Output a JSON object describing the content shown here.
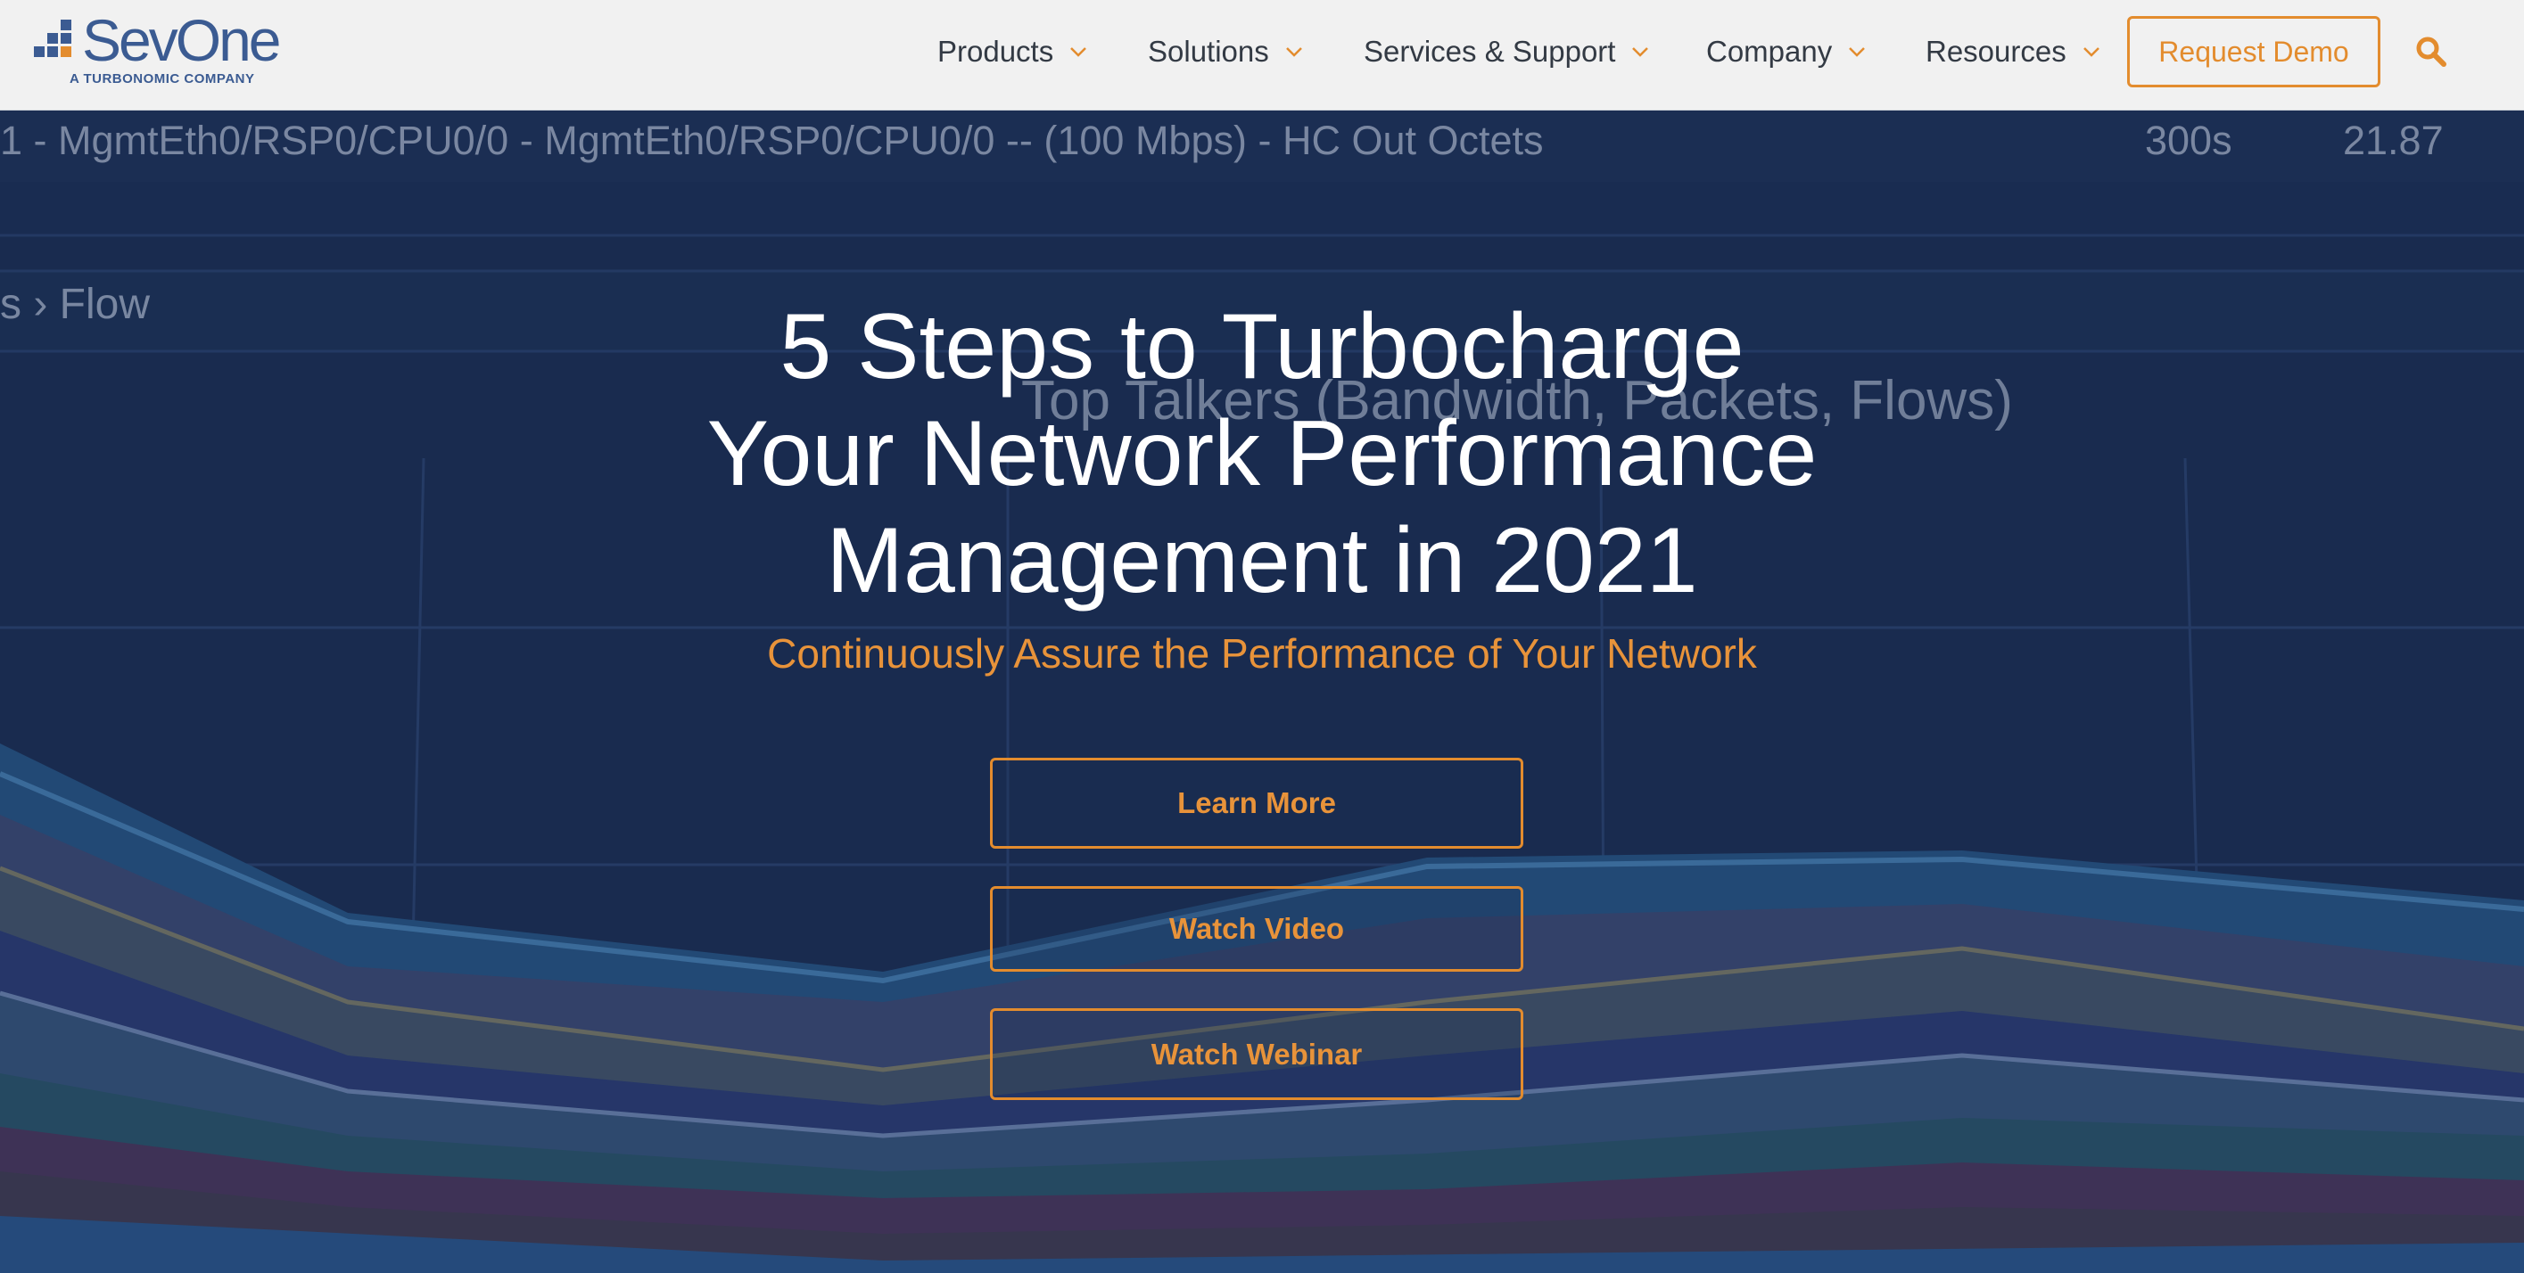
{
  "brand": {
    "name": "SevOne",
    "tagline": "A TURBONOMIC COMPANY",
    "color": "#3b5b92"
  },
  "nav": {
    "items": [
      {
        "label": "Products"
      },
      {
        "label": "Solutions"
      },
      {
        "label": "Services & Support"
      },
      {
        "label": "Company"
      },
      {
        "label": "Resources"
      }
    ],
    "demo_label": "Request Demo",
    "search_icon": "search-icon",
    "accent": "#e38c2e"
  },
  "hero": {
    "background_text": {
      "interface_row": "1 - MgmtEth0/RSP0/CPU0/0 - MgmtEth0/RSP0/CPU0/0 -- (100 Mbps) - HC Out Octets",
      "interval": "300s",
      "value": "21.87",
      "breadcrumb": "s › Flow",
      "chart_title": "Top Talkers (Bandwidth, Packets, Flows)"
    },
    "headline_lines": [
      "5 Steps to Turbocharge",
      "Your Network Performance",
      "Management in 2021"
    ],
    "subheadline": "Continuously Assure the Performance of Your Network",
    "buttons": {
      "learn_more": "Learn More",
      "watch_video": "Watch Video",
      "watch_webinar": "Watch Webinar"
    }
  }
}
